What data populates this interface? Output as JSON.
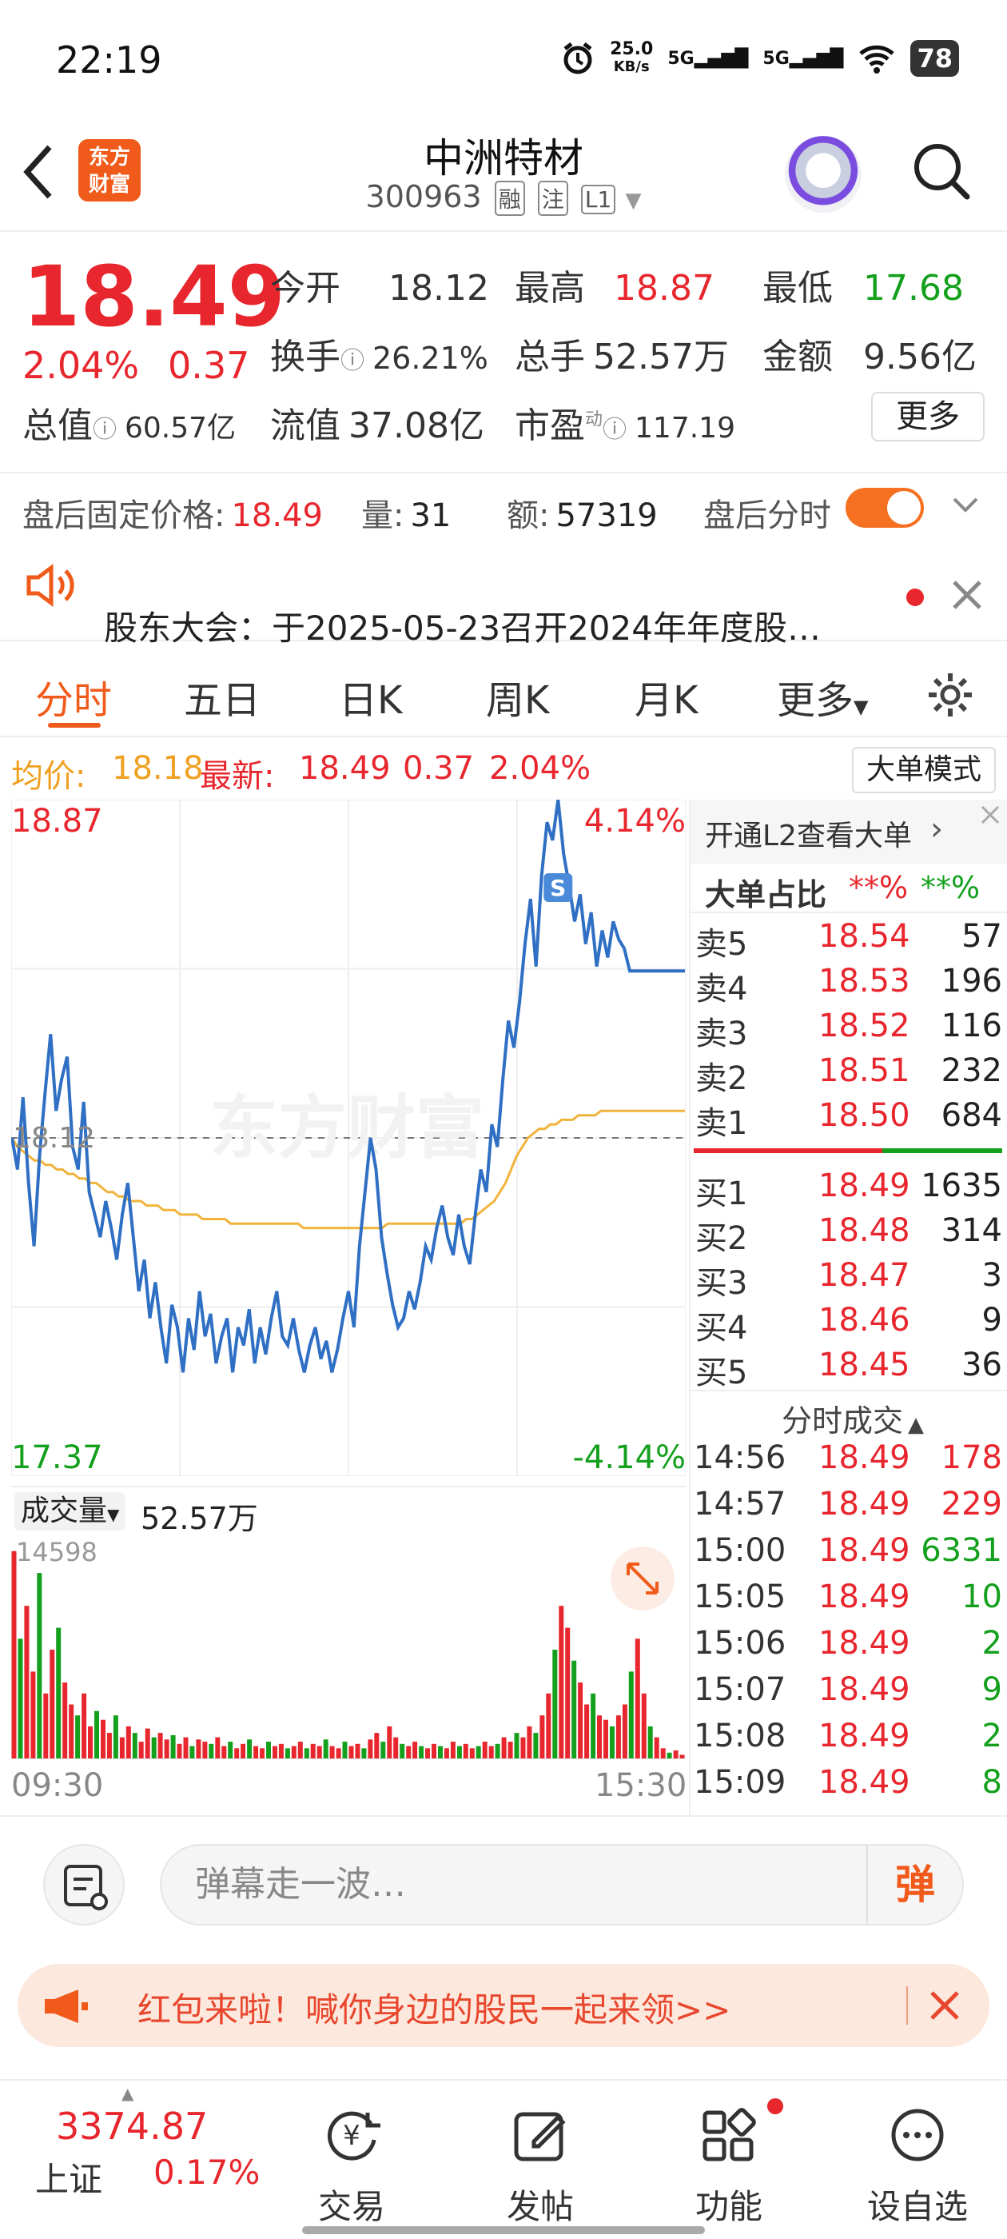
{
  "status_bar": {
    "time": "22:19",
    "net_speed_top": "25.0",
    "net_speed_unit": "KB/s",
    "sim1": "5G",
    "sim2": "5G",
    "battery": "78"
  },
  "header": {
    "app_logo_line1": "东方",
    "app_logo_line2": "财富",
    "stock_name": "中洲特材",
    "stock_code": "300963",
    "tags": [
      "融",
      "注",
      "L1"
    ]
  },
  "quote": {
    "price": "18.49",
    "change_pct": "2.04%",
    "change_val": "0.37",
    "open_label": "今开",
    "open": "18.12",
    "high_label": "最高",
    "high": "18.87",
    "low_label": "最低",
    "low": "17.68",
    "turnover_label": "换手",
    "turnover": "26.21%",
    "volume_label": "总手",
    "volume": "52.57万",
    "amount_label": "金额",
    "amount": "9.56亿",
    "mktcap_label": "总值",
    "mktcap": "60.57亿",
    "float_label": "流值",
    "float": "37.08亿",
    "pe_label": "市盈",
    "pe_sup": "动",
    "pe": "117.19",
    "more_label": "更多"
  },
  "after_hours": {
    "price_label": "盘后固定价格:",
    "price": "18.49",
    "vol_label": "量:",
    "vol": "31",
    "amt_label": "额:",
    "amt": "57319",
    "toggle_label": "盘后分时"
  },
  "notice": {
    "text": "股东大会：于2025-05-23召开2024年年度股…"
  },
  "tabs": [
    "分时",
    "五日",
    "日K",
    "周K",
    "月K",
    "更多"
  ],
  "chart_header": {
    "avg_label": "均价:",
    "avg": "18.18",
    "latest_label": "最新:",
    "latest": "18.49",
    "change": "0.37",
    "change_pct": "2.04%",
    "big_order_mode": "大单模式"
  },
  "chart_data": {
    "type": "line",
    "y_max_label": "18.87",
    "y_min_label": "17.37",
    "pct_max_label": "4.14%",
    "pct_min_label": "-4.14%",
    "prev_close_label": "18.12",
    "ylim": [
      17.37,
      18.87
    ],
    "x_start_label": "09:30",
    "x_end_label": "15:30",
    "marker_label": "S",
    "series": [
      {
        "values": [
          18.12,
          18.05,
          18.21,
          18.02,
          17.88,
          18.08,
          18.22,
          18.35,
          18.18,
          18.25,
          18.3,
          18.1,
          18.05,
          18.2,
          18.0,
          17.95,
          17.9,
          17.98,
          17.92,
          17.85,
          17.95,
          18.02,
          17.9,
          17.78,
          17.85,
          17.72,
          17.8,
          17.7,
          17.62,
          17.75,
          17.7,
          17.6,
          17.72,
          17.65,
          17.78,
          17.68,
          17.73,
          17.62,
          17.68,
          17.72,
          17.6,
          17.7,
          17.66,
          17.74,
          17.62,
          17.7,
          17.64,
          17.72,
          17.78,
          17.68,
          17.66,
          17.72,
          17.65,
          17.6,
          17.66,
          17.7,
          17.63,
          17.67,
          17.6,
          17.65,
          17.72,
          17.78,
          17.7,
          17.88,
          18.0,
          18.12,
          18.05,
          17.9,
          17.82,
          17.75,
          17.7,
          17.72,
          17.78,
          17.74,
          17.8,
          17.88,
          17.85,
          17.92,
          17.97,
          17.9,
          17.86,
          17.95,
          17.88,
          17.84,
          17.95,
          18.05,
          18.0,
          18.15,
          18.1,
          18.25,
          18.38,
          18.32,
          18.42,
          18.55,
          18.65,
          18.5,
          18.7,
          18.82,
          18.78,
          18.87,
          18.75,
          18.68,
          18.6,
          18.66,
          18.55,
          18.62,
          18.5,
          18.58,
          18.52,
          18.6,
          18.56,
          18.54,
          18.49,
          18.49,
          18.49,
          18.49,
          18.49,
          18.49,
          18.49,
          18.49,
          18.49,
          18.49,
          18.49
        ]
      },
      {
        "values": [
          18.12,
          18.1,
          18.09,
          18.08,
          18.07,
          18.07,
          18.06,
          18.06,
          18.05,
          18.05,
          18.04,
          18.04,
          18.03,
          18.03,
          18.02,
          18.02,
          18.01,
          18.0,
          18.0,
          17.99,
          17.99,
          17.98,
          17.98,
          17.98,
          17.97,
          17.97,
          17.97,
          17.96,
          17.96,
          17.96,
          17.95,
          17.95,
          17.95,
          17.95,
          17.94,
          17.94,
          17.94,
          17.94,
          17.94,
          17.93,
          17.93,
          17.93,
          17.93,
          17.93,
          17.93,
          17.93,
          17.93,
          17.93,
          17.93,
          17.93,
          17.93,
          17.93,
          17.92,
          17.92,
          17.92,
          17.92,
          17.92,
          17.92,
          17.92,
          17.92,
          17.92,
          17.92,
          17.92,
          17.92,
          17.92,
          17.92,
          17.92,
          17.93,
          17.93,
          17.93,
          17.93,
          17.93,
          17.93,
          17.93,
          17.93,
          17.93,
          17.93,
          17.93,
          17.93,
          17.93,
          17.93,
          17.94,
          17.94,
          17.95,
          17.96,
          17.97,
          17.98,
          18.0,
          18.02,
          18.05,
          18.08,
          18.1,
          18.12,
          18.13,
          18.14,
          18.14,
          18.15,
          18.15,
          18.16,
          18.16,
          18.16,
          18.17,
          18.17,
          18.17,
          18.17,
          18.18,
          18.18,
          18.18,
          18.18,
          18.18,
          18.18,
          18.18,
          18.18,
          18.18,
          18.18,
          18.18,
          18.18,
          18.18,
          18.18,
          18.18,
          18.18
        ]
      }
    ]
  },
  "volume": {
    "label": "成交量",
    "total": "52.57万",
    "max_label": "14598",
    "bars": [
      0.95,
      0.55,
      0.7,
      0.4,
      0.85,
      0.3,
      0.5,
      0.6,
      0.35,
      0.25,
      0.2,
      0.3,
      0.15,
      0.22,
      0.18,
      0.12,
      0.2,
      0.1,
      0.15,
      0.12,
      0.08,
      0.14,
      0.1,
      0.12,
      0.09,
      0.11,
      0.07,
      0.1,
      0.06,
      0.09,
      0.08,
      0.07,
      0.1,
      0.06,
      0.08,
      0.05,
      0.07,
      0.09,
      0.06,
      0.05,
      0.08,
      0.06,
      0.07,
      0.05,
      0.06,
      0.08,
      0.05,
      0.07,
      0.06,
      0.09,
      0.06,
      0.05,
      0.08,
      0.06,
      0.07,
      0.05,
      0.09,
      0.12,
      0.08,
      0.15,
      0.1,
      0.07,
      0.06,
      0.08,
      0.06,
      0.05,
      0.07,
      0.06,
      0.05,
      0.08,
      0.06,
      0.07,
      0.05,
      0.06,
      0.08,
      0.06,
      0.07,
      0.1,
      0.08,
      0.12,
      0.1,
      0.15,
      0.12,
      0.2,
      0.3,
      0.5,
      0.7,
      0.6,
      0.45,
      0.35,
      0.25,
      0.3,
      0.2,
      0.18,
      0.15,
      0.2,
      0.25,
      0.4,
      0.55,
      0.3,
      0.15,
      0.1,
      0.05,
      0.03,
      0.04,
      0.02
    ],
    "up_color": "#e8262d",
    "down_color": "#14a01d"
  },
  "right_panel": {
    "promo": "开通L2查看大单",
    "big_ratio_label": "大单占比",
    "big_ratio_buy": "**%",
    "big_ratio_sell": "**%",
    "asks": [
      {
        "label": "卖5",
        "price": "18.54",
        "qty": "57"
      },
      {
        "label": "卖4",
        "price": "18.53",
        "qty": "196"
      },
      {
        "label": "卖3",
        "price": "18.52",
        "qty": "116"
      },
      {
        "label": "卖2",
        "price": "18.51",
        "qty": "232"
      },
      {
        "label": "卖1",
        "price": "18.50",
        "qty": "684"
      }
    ],
    "bids": [
      {
        "label": "买1",
        "price": "18.49",
        "qty": "1635"
      },
      {
        "label": "买2",
        "price": "18.48",
        "qty": "314"
      },
      {
        "label": "买3",
        "price": "18.47",
        "qty": "3"
      },
      {
        "label": "买4",
        "price": "18.46",
        "qty": "9"
      },
      {
        "label": "买5",
        "price": "18.45",
        "qty": "36"
      }
    ],
    "trades_title": "分时成交",
    "trades": [
      {
        "time": "14:56",
        "price": "18.49",
        "qty": "178",
        "dir": "buy"
      },
      {
        "time": "14:57",
        "price": "18.49",
        "qty": "229",
        "dir": "buy"
      },
      {
        "time": "15:00",
        "price": "18.49",
        "qty": "6331",
        "dir": "sell"
      },
      {
        "time": "15:05",
        "price": "18.49",
        "qty": "10",
        "dir": "sell"
      },
      {
        "time": "15:06",
        "price": "18.49",
        "qty": "2",
        "dir": "sell"
      },
      {
        "time": "15:07",
        "price": "18.49",
        "qty": "9",
        "dir": "sell"
      },
      {
        "time": "15:08",
        "price": "18.49",
        "qty": "2",
        "dir": "sell"
      },
      {
        "time": "15:09",
        "price": "18.49",
        "qty": "8",
        "dir": "sell"
      }
    ]
  },
  "bullet": {
    "placeholder": "弹幕走一波…",
    "send_label": "弹"
  },
  "promo": {
    "text": "红包来啦！喊你身边的股民一起来领>>"
  },
  "bottom_nav": {
    "index_value": "3374.87",
    "index_name": "上证",
    "index_change": "0.17%",
    "items": [
      "交易",
      "发帖",
      "功能",
      "设自选"
    ]
  },
  "colors": {
    "accent": "#f05a1a",
    "up": "#e8262d",
    "down": "#14a01d",
    "price_line": "#2f6fc4",
    "avg_line": "#f0b43c"
  }
}
